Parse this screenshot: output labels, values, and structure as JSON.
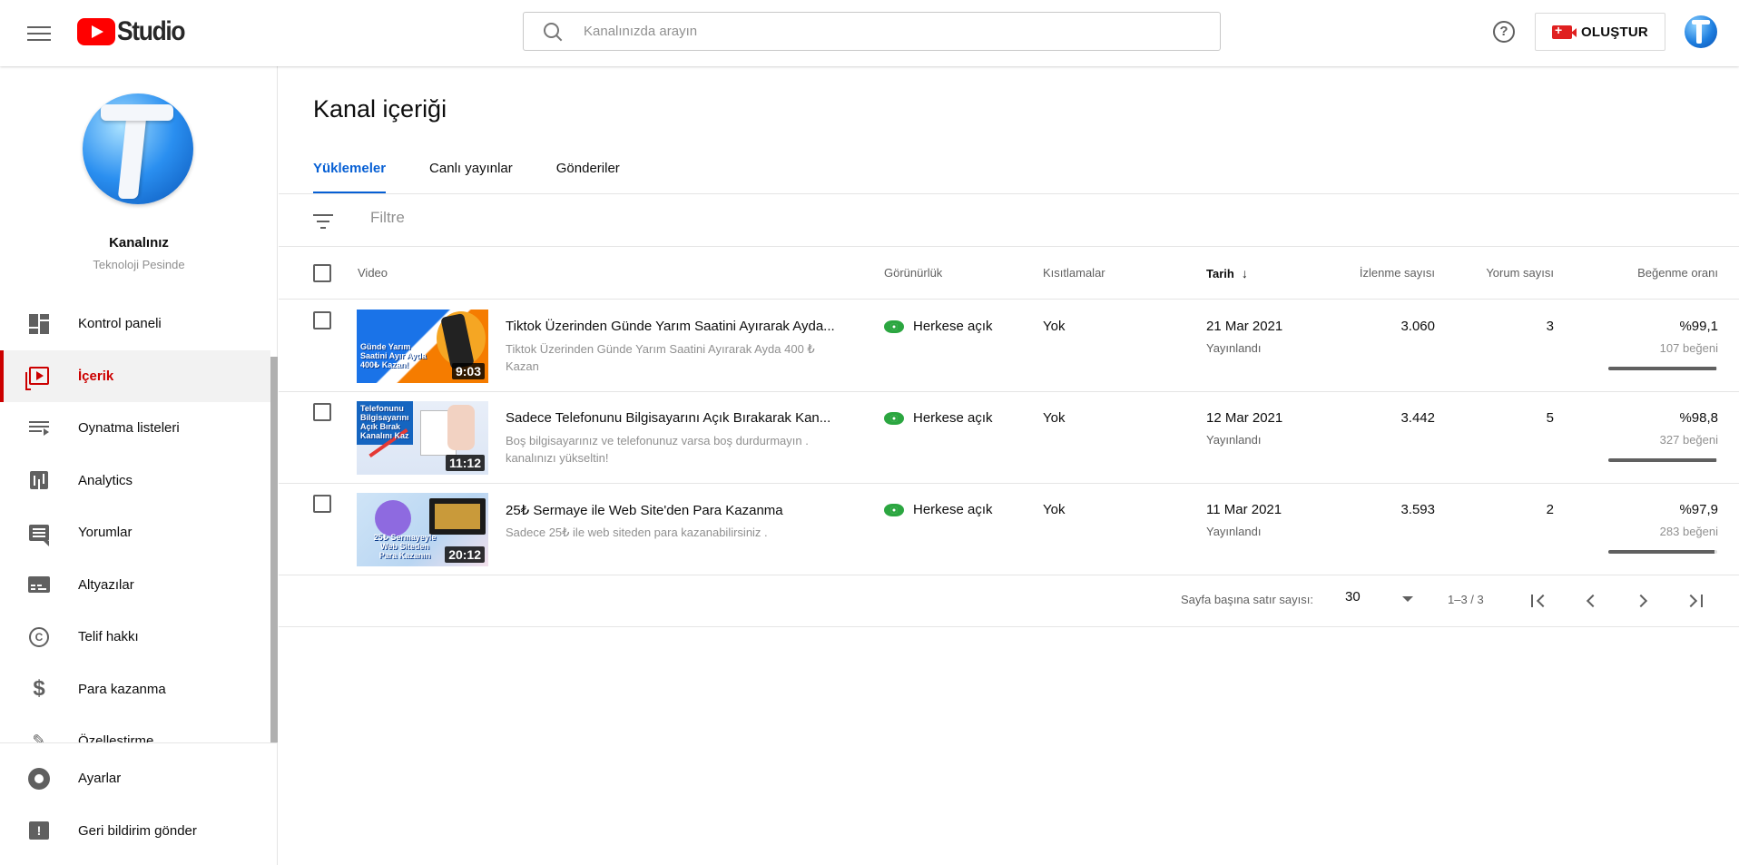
{
  "header": {
    "logo_text": "Studio",
    "search_placeholder": "Kanalınızda arayın",
    "help_glyph": "?",
    "create_label": "OLUŞTUR"
  },
  "sidebar": {
    "channel_name": "Kanalınız",
    "channel_sub": "Teknoloji Pesinde",
    "items": [
      {
        "label": "Kontrol paneli",
        "icon": "dashboard-icon"
      },
      {
        "label": "İçerik",
        "icon": "content-icon",
        "active": true
      },
      {
        "label": "Oynatma listeleri",
        "icon": "playlist-icon"
      },
      {
        "label": "Analytics",
        "icon": "analytics-icon"
      },
      {
        "label": "Yorumlar",
        "icon": "comments-icon"
      },
      {
        "label": "Altyazılar",
        "icon": "subtitles-icon"
      },
      {
        "label": "Telif hakkı",
        "icon": "copyright-icon"
      },
      {
        "label": "Para kazanma",
        "icon": "dollar-icon"
      },
      {
        "label": "Özelleştirme",
        "icon": "customization-icon"
      }
    ],
    "bottom": [
      {
        "label": "Ayarlar",
        "icon": "gear-icon"
      },
      {
        "label": "Geri bildirim gönder",
        "icon": "feedback-icon"
      }
    ]
  },
  "main": {
    "title": "Kanal içeriği",
    "tabs": [
      "Yüklemeler",
      "Canlı yayınlar",
      "Gönderiler"
    ],
    "filter_placeholder": "Filtre",
    "columns": {
      "video": "Video",
      "visibility": "Görünürlük",
      "restrictions": "Kısıtlamalar",
      "date": "Tarih",
      "views": "İzlenme sayısı",
      "comments": "Yorum sayısı",
      "likes": "Beğenme oranı"
    },
    "sort_glyph": "↓",
    "videos": [
      {
        "title": "Tiktok Üzerinden Günde Yarım Saatini Ayırarak Ayda...",
        "description": "Tiktok Üzerinden Günde Yarım Saatini Ayırarak Ayda 400 ₺ Kazan",
        "duration": "9:03",
        "thumb_text": "Günde Yarım Saatini Ayır Ayda 400₺ Kazan!",
        "visibility": "Herkese açık",
        "restrictions": "Yok",
        "date": "21 Mar 2021",
        "date_status": "Yayınlandı",
        "views": "3.060",
        "comments": "3",
        "like_ratio": "%99,1",
        "like_count": "107 beğeni",
        "like_fraction": 0.991
      },
      {
        "title": "Sadece Telefonunu Bilgisayarını Açık Bırakarak Kan...",
        "description": "Boş bilgisayarınız ve telefonunuz varsa boş durdurmayın . kanalınızı yükseltin!",
        "duration": "11:12",
        "thumb_text": "Telefonunu Bilgisayarını Açık Bırak Kanalını Kaz",
        "visibility": "Herkese açık",
        "restrictions": "Yok",
        "date": "12 Mar 2021",
        "date_status": "Yayınlandı",
        "views": "3.442",
        "comments": "5",
        "like_ratio": "%98,8",
        "like_count": "327 beğeni",
        "like_fraction": 0.988
      },
      {
        "title": "25₺ Sermaye ile Web Site'den Para Kazanma",
        "description": "Sadece 25₺ ile web siteden para kazanabilirsiniz .",
        "duration": "20:12",
        "thumb_text": "25₺ Sermayeyle Web Siteden Para Kazanın",
        "visibility": "Herkese açık",
        "restrictions": "Yok",
        "date": "11 Mar 2021",
        "date_status": "Yayınlandı",
        "views": "3.593",
        "comments": "2",
        "like_ratio": "%97,9",
        "like_count": "283 beğeni",
        "like_fraction": 0.979
      }
    ],
    "pager": {
      "rows_label": "Sayfa başına satır sayısı:",
      "rows_value": "30",
      "range": "1–3 / 3"
    }
  },
  "colors": {
    "accent": "#065fd4",
    "brand_red": "#cc0000",
    "public_green": "#2ba640"
  }
}
